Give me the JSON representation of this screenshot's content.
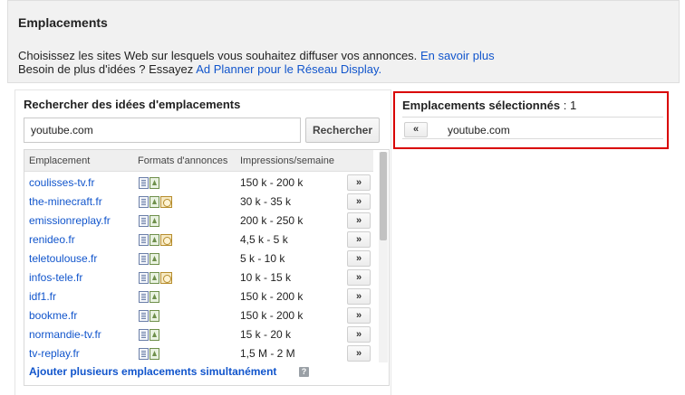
{
  "header": {
    "title": "Emplacements",
    "line1_text": "Choisissez les sites Web sur lesquels vous souhaitez diffuser vos annonces.",
    "line1_link": "En savoir plus",
    "line2_text": "Besoin de plus d'idées ? Essayez",
    "line2_link": "Ad Planner pour le Réseau Display."
  },
  "search": {
    "title": "Rechercher des idées d'emplacements",
    "query": "youtube.com",
    "button_label": "Rechercher"
  },
  "results": {
    "columns": {
      "placement": "Emplacement",
      "formats": "Formats d'annonces",
      "impressions": "Impressions/semaine"
    },
    "add_label": "»",
    "rows": [
      {
        "site": "coulisses-tv.fr",
        "formats": [
          "text",
          "image"
        ],
        "impressions": "150 k - 200 k"
      },
      {
        "site": "the-minecraft.fr",
        "formats": [
          "text",
          "image",
          "video"
        ],
        "impressions": "30 k - 35 k"
      },
      {
        "site": "emissionreplay.fr",
        "formats": [
          "text",
          "image"
        ],
        "impressions": "200 k - 250 k"
      },
      {
        "site": "renideo.fr",
        "formats": [
          "text",
          "image",
          "video"
        ],
        "impressions": "4,5 k - 5 k"
      },
      {
        "site": "teletoulouse.fr",
        "formats": [
          "text",
          "image"
        ],
        "impressions": "5 k - 10 k"
      },
      {
        "site": "infos-tele.fr",
        "formats": [
          "text",
          "image",
          "video"
        ],
        "impressions": "10 k - 15 k"
      },
      {
        "site": "idf1.fr",
        "formats": [
          "text",
          "image"
        ],
        "impressions": "150 k - 200 k"
      },
      {
        "site": "bookme.fr",
        "formats": [
          "text",
          "image"
        ],
        "impressions": "150 k - 200 k"
      },
      {
        "site": "normandie-tv.fr",
        "formats": [
          "text",
          "image"
        ],
        "impressions": "15 k - 20 k"
      },
      {
        "site": "tv-replay.fr",
        "formats": [
          "text",
          "image"
        ],
        "impressions": "1,5 M - 2 M"
      }
    ],
    "add_multiple": "Ajouter plusieurs emplacements simultanément",
    "help_glyph": "?"
  },
  "selected": {
    "title": "Emplacements sélectionnés",
    "count": ": 1",
    "remove_label": "«",
    "items": [
      "youtube.com"
    ]
  }
}
